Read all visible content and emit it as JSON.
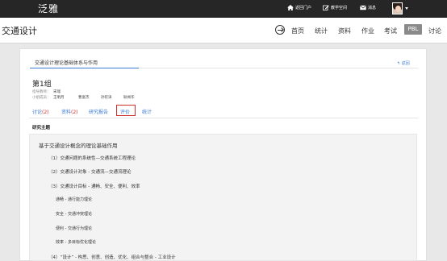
{
  "header": {
    "logo": "泛雅",
    "nav": [
      {
        "label": "返回门户",
        "icon": "home-icon"
      },
      {
        "label": "教学空间",
        "icon": "edit-icon"
      },
      {
        "label": "消息",
        "icon": "mail-icon"
      }
    ]
  },
  "course": {
    "title": "交通设计",
    "nav": [
      "首页",
      "统计",
      "资料",
      "作业",
      "考试",
      "PBL",
      "讨论"
    ],
    "active_nav": "PBL"
  },
  "card": {
    "tab_label": "交通设计理论基础体系与作用",
    "back_label": "返回",
    "group_title": "第1组",
    "advisor_label": "指导教师：",
    "advisor": "宋瑞",
    "members_label": "小组成员：",
    "members": [
      "王明月",
      "曹富杰",
      "孙钦涛",
      "耿闻华"
    ],
    "tabs": [
      {
        "label": "讨论",
        "count": "(2)"
      },
      {
        "label": "资料",
        "count": "(2)"
      },
      {
        "label": "研究报告",
        "count": ""
      },
      {
        "label": "评价",
        "count": ""
      },
      {
        "label": "统计",
        "count": ""
      }
    ],
    "active_tab": "评价",
    "section_title": "研究主题",
    "topic": {
      "heading": "基于交通设计概念的理论基础作用",
      "lines": [
        "（1）交通问题的系统性—交通系统工程理论",
        "（2）交通设计对象 - 交通流—交通流理论",
        "（3）交通设计目标 - 通畅、安全、便利、效率",
        "通畅 - 通行能力理论",
        "安全 - 交通冲突理论",
        "便利 - 交通行为理论",
        "效率 - 多目标优化理论",
        "（4）“设计” - 构思、创意、创造、优化、组合与整合 - 工业设计"
      ]
    }
  },
  "colors": {
    "topbar": "#262626",
    "link": "#3a7bd5",
    "count": "#d0302a",
    "active_tab_outline": "#d0302a",
    "pbl_bg": "#8a8a8a"
  }
}
